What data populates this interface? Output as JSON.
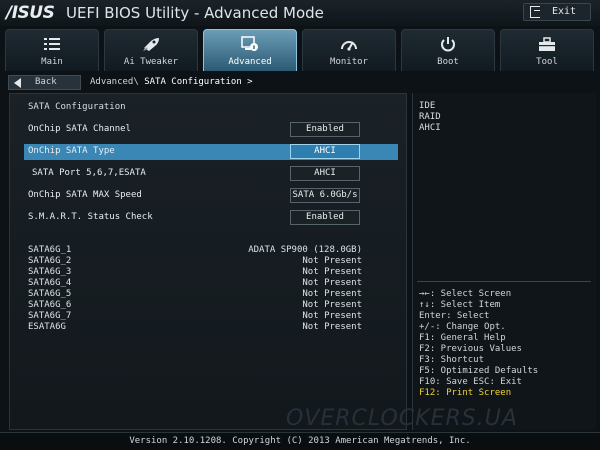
{
  "title_bar": {
    "logo": "/ISUS",
    "title": "UEFI BIOS Utility - Advanced Mode",
    "exit_label": "Exit",
    "exit_icon": "exit-door-icon"
  },
  "tabs": [
    {
      "label": "Main",
      "icon": "list-icon",
      "active": false
    },
    {
      "label": "Ai Tweaker",
      "icon": "rocket-icon",
      "active": false
    },
    {
      "label": "Advanced",
      "icon": "screen-info-icon",
      "active": true
    },
    {
      "label": "Monitor",
      "icon": "gauge-icon",
      "active": false
    },
    {
      "label": "Boot",
      "icon": "power-icon",
      "active": false
    },
    {
      "label": "Tool",
      "icon": "toolbox-icon",
      "active": false
    }
  ],
  "nav": {
    "back_label": "Back",
    "crumb_prefix": "Advanced\\",
    "crumb_current": "SATA Configuration >"
  },
  "main": {
    "section_title": "SATA Configuration",
    "settings": [
      {
        "label": "OnChip SATA Channel",
        "value": "Enabled",
        "highlighted": false
      },
      {
        "label": "OnChip SATA Type",
        "value": "AHCI",
        "highlighted": true
      },
      {
        "label": "SATA Port 5,6,7,ESATA",
        "value": "AHCI",
        "highlighted": false
      },
      {
        "label": "OnChip SATA MAX Speed",
        "value": "SATA 6.0Gb/s",
        "highlighted": false
      },
      {
        "label": "S.M.A.R.T. Status Check",
        "value": "Enabled",
        "highlighted": false
      }
    ],
    "devices": [
      {
        "name": "SATA6G_1",
        "status": "ADATA SP900     (128.0GB)"
      },
      {
        "name": "SATA6G_2",
        "status": "Not Present"
      },
      {
        "name": "SATA6G_3",
        "status": "Not Present"
      },
      {
        "name": "SATA6G_4",
        "status": "Not Present"
      },
      {
        "name": "SATA6G_5",
        "status": "Not Present"
      },
      {
        "name": "SATA6G_6",
        "status": "Not Present"
      },
      {
        "name": "SATA6G_7",
        "status": "Not Present"
      },
      {
        "name": "ESATA6G",
        "status": "Not Present"
      }
    ]
  },
  "help": {
    "options": [
      "IDE",
      "RAID",
      "AHCI"
    ],
    "keys": [
      "→←: Select Screen",
      "↑↓: Select Item",
      "Enter: Select",
      "+/-: Change Opt.",
      "F1: General Help",
      "F2: Previous Values",
      "F3: Shortcut",
      "F5: Optimized Defaults",
      "F10: Save  ESC: Exit",
      "F12: Print Screen"
    ]
  },
  "watermark": "OVERCLOCKERS.UA",
  "footer": "Version 2.10.1208. Copyright (C) 2013 American Megatrends, Inc.",
  "colors": {
    "highlight": "#3a87b6",
    "active_tab": "#6c9db7",
    "f12_key": "#f2d23a"
  }
}
